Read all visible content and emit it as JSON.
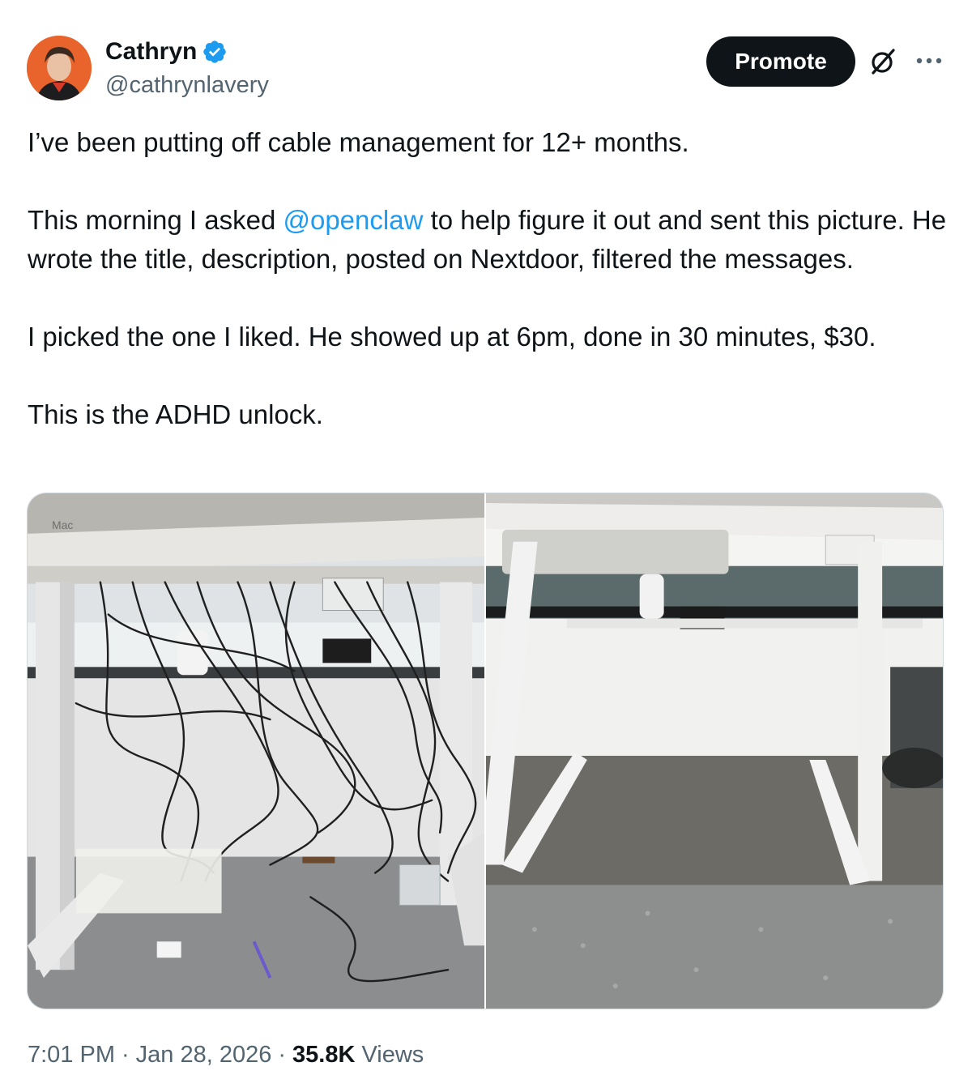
{
  "author": {
    "display_name": "Cathryn",
    "handle": "@cathrynlavery",
    "verified": true,
    "avatar": "avatar-photo"
  },
  "actions": {
    "promote_label": "Promote",
    "grok_icon": "grok-icon",
    "more_icon": "more-icon"
  },
  "tweet": {
    "para1": "I’ve been putting off cable management for 12+ months.",
    "para2_before": "This morning I asked ",
    "para2_mention": "@openclaw",
    "para2_after": " to help figure it out and sent this picture. He wrote the title, description, posted on Nextdoor,  filtered the messages.",
    "para3": "I picked the one I liked. He showed up at 6pm, done in 30 minutes, $30.",
    "para4": "This is the ADHD unlock."
  },
  "media": {
    "photos": [
      {
        "label": "Mac"
      },
      {}
    ]
  },
  "meta": {
    "time": "7:01 PM",
    "date": "Jan 28, 2026",
    "views_count": "35.8K",
    "views_label": "Views",
    "separator": "·"
  },
  "colors": {
    "link": "#1d9bf0",
    "text": "#0f1419",
    "secondary": "#536471",
    "verified": "#1d9bf0"
  }
}
